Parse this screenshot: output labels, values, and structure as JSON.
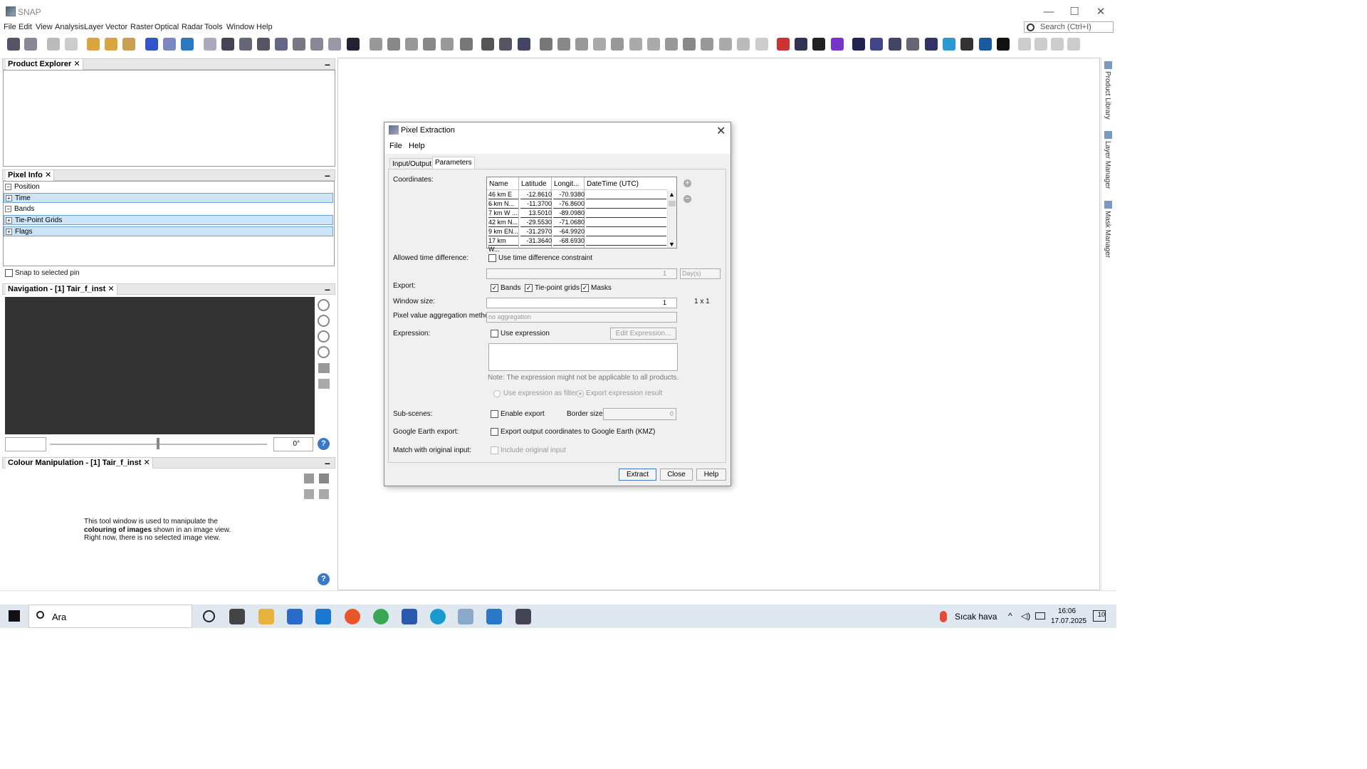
{
  "window": {
    "title": "SNAP",
    "minimize": "—",
    "maximize": "☐",
    "close": "✕"
  },
  "menubar": [
    "File",
    "Edit",
    "View",
    "Analysis",
    "Layer",
    "Vector",
    "Raster",
    "Optical",
    "Radar",
    "Tools",
    "Window",
    "Help"
  ],
  "search": {
    "placeholder": "Search (Ctrl+I)"
  },
  "product_explorer": {
    "title": "Product Explorer"
  },
  "pixel_info": {
    "title": "Pixel Info",
    "rows": [
      {
        "label": "Position",
        "sign": "−"
      },
      {
        "label": "Time",
        "sign": "+"
      },
      {
        "label": "Bands",
        "sign": "−"
      },
      {
        "label": "Tie-Point Grids",
        "sign": "+"
      },
      {
        "label": "Flags",
        "sign": "+"
      }
    ],
    "snap_label": "Snap to selected pin"
  },
  "navigation": {
    "title": "Navigation - [1] Tair_f_inst",
    "rotation": "0°"
  },
  "colour": {
    "title": "Colour Manipulation - [1] Tair_f_inst",
    "msg1": "This tool window is used to manipulate the",
    "msg2": "colouring of images",
    "msg2b": " shown in an image view.",
    "msg3": "Right now, there is no selected image view."
  },
  "sidebar": {
    "items": [
      "Product Library",
      "Layer Manager",
      "Mask Manager"
    ]
  },
  "dialog": {
    "title": "Pixel Extraction",
    "menu": [
      "File",
      "Help"
    ],
    "tabs": [
      "Input/Output",
      "Parameters"
    ],
    "coordinates_label": "Coordinates:",
    "table_headers": [
      "Name",
      "Latitude",
      "Longit...",
      "DateTime (UTC)"
    ],
    "rows": [
      [
        "46 km E ...",
        "-12.8610",
        "-70.9380",
        ""
      ],
      [
        "6 km N...",
        "-11.3700",
        "-76.8600",
        ""
      ],
      [
        "7 km W ...",
        "13.5010",
        "-89.0980",
        ""
      ],
      [
        "42 km N...",
        "-29.5530",
        "-71.0680",
        ""
      ],
      [
        "9 km EN...",
        "-31.2970",
        "-64.9920",
        ""
      ],
      [
        "17 km W...",
        "-31.3640",
        "-68.6930",
        ""
      ]
    ],
    "allowed_time_label": "Allowed time difference:",
    "use_time_label": "Use time difference constraint",
    "time_value": "1",
    "time_unit": "Day(s)",
    "export_label": "Export:",
    "export_bands": "Bands",
    "export_tpg": "Tie-point grids",
    "export_masks": "Masks",
    "window_size_label": "Window size:",
    "window_size_value": "1",
    "window_size_text": "1 x 1",
    "aggregation_label": "Pixel value aggregation method:",
    "aggregation_value": "no aggregation",
    "expression_label": "Expression:",
    "use_expression": "Use expression",
    "edit_expression": "Edit Expression...",
    "note": "Note: The expression might not be applicable to all products.",
    "use_as_filter": "Use expression as filter",
    "export_result": "Export expression result",
    "subscenes_label": "Sub-scenes:",
    "enable_export": "Enable export",
    "border_size_label": "Border size:",
    "border_size_value": "0",
    "google_label": "Google Earth export:",
    "google_text": "Export output coordinates to Google Earth (KMZ)",
    "match_label": "Match with original input:",
    "include_original": "Include original input",
    "btn_extract": "Extract",
    "btn_close": "Close",
    "btn_help": "Help"
  },
  "taskbar": {
    "search": "Ara",
    "weather": "Sıcak hava",
    "time": "16:06",
    "date": "17.07.2025",
    "notif": "10"
  }
}
